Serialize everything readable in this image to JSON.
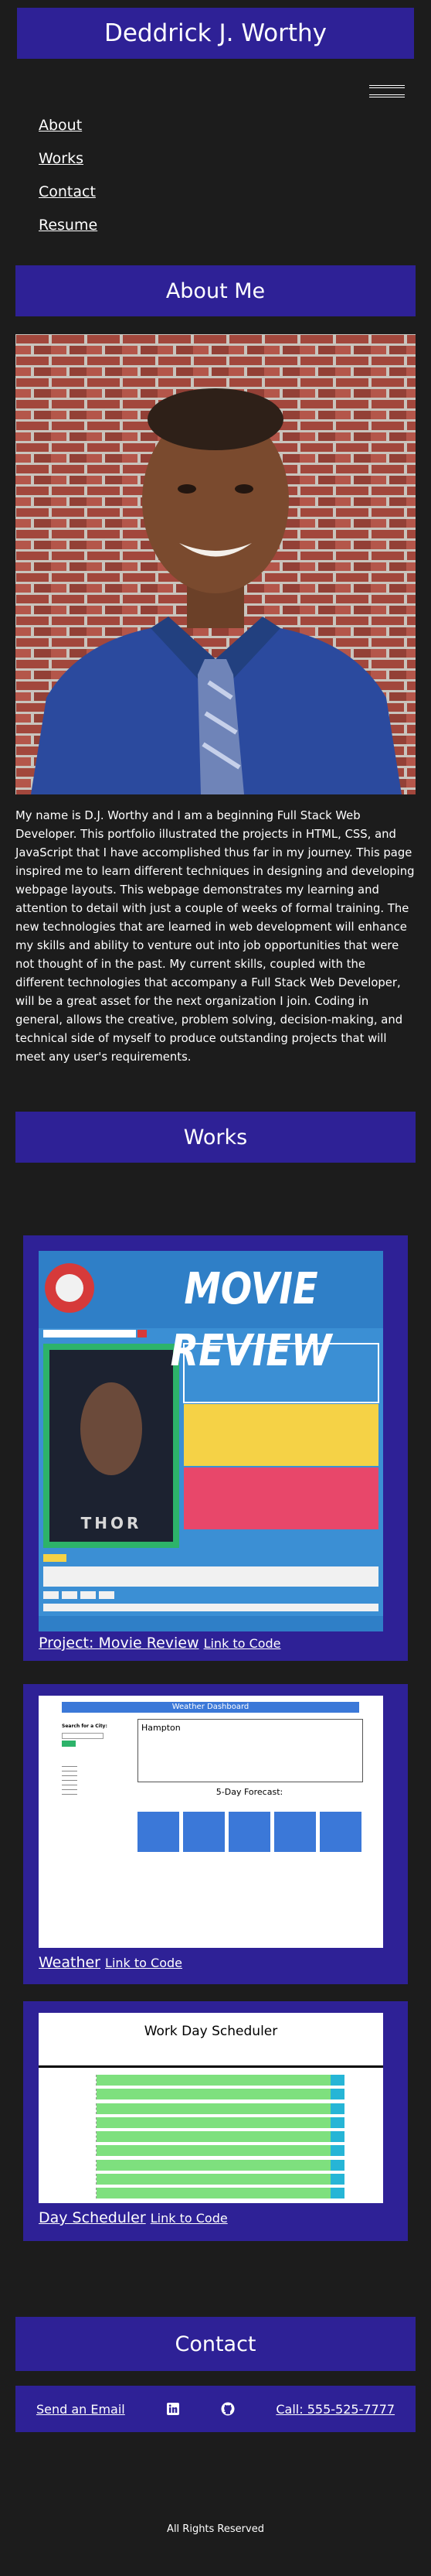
{
  "header": {
    "title": "Deddrick J. Worthy"
  },
  "nav": [
    {
      "label": "About"
    },
    {
      "label": "Works"
    },
    {
      "label": "Contact"
    },
    {
      "label": "Resume"
    }
  ],
  "about": {
    "heading": "About Me",
    "text": "My name is D.J. Worthy and I am a beginning Full Stack Web Developer. This portfolio illustrated the projects in HTML, CSS, and JavaScript that I have accomplished thus far in my journey. This page inspired me to learn different techniques in designing and developing webpage layouts. This webpage demonstrates my learning and attention to detail with just a couple of weeks of formal training. The new technologies that are learned in web development will enhance my skills and ability to venture out into job opportunities that were not thought of in the past. My current skills, coupled with the different technologies that accompany a Full Stack Web Developer, will be a great asset for the next organization I join. Coding in general, allows the creative, problem solving, decision-making, and technical side of myself to produce outstanding projects that will meet any user's requirements."
  },
  "works": {
    "heading": "Works",
    "items": [
      {
        "title": "Project: Movie Review",
        "code_link": "Link to Code",
        "banner": "MOVIE REVIEW",
        "poster_title": "THOR"
      },
      {
        "title": "Weather",
        "code_link": "Link to Code",
        "banner": "Weather Dashboard",
        "search_label": "Search for a City:",
        "city": "Hampton",
        "forecast_label": "5-Day Forecast:"
      },
      {
        "title": "Day Scheduler",
        "code_link": "Link to Code",
        "banner": "Work Day Scheduler"
      }
    ]
  },
  "contact": {
    "heading": "Contact",
    "email_label": "Send an Email",
    "linkedin_icon": "linkedin-icon",
    "github_icon": "github-icon",
    "phone_label": "Call: 555-525-7777"
  },
  "footer": {
    "rights": "All Rights Reserved"
  },
  "colors": {
    "accent": "#2e2196",
    "background": "#1c1c1c",
    "text": "#ffffff"
  }
}
